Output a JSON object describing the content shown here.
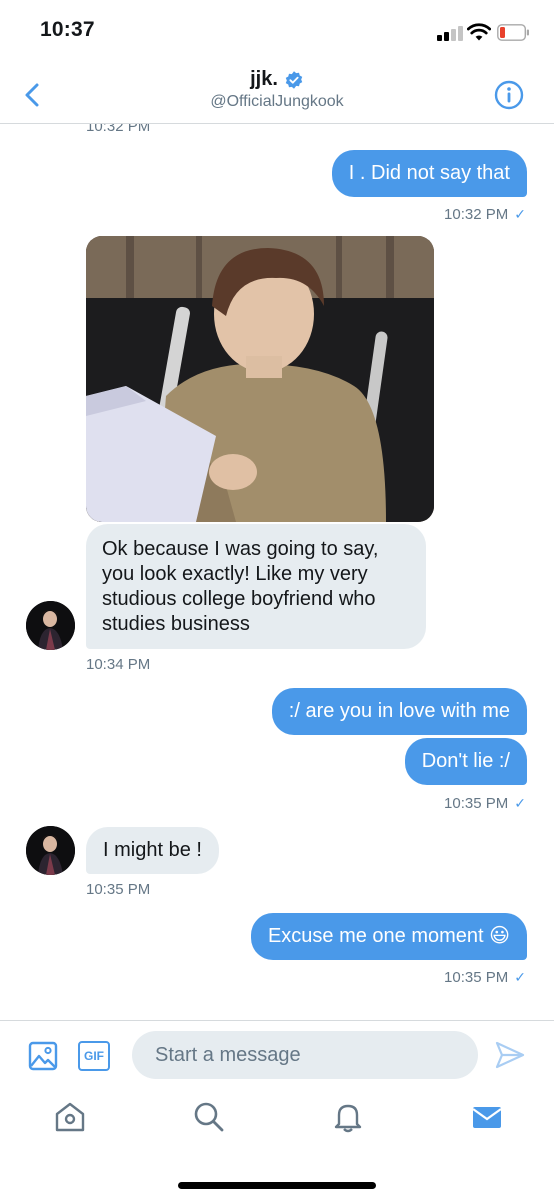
{
  "status_bar": {
    "time": "10:37"
  },
  "header": {
    "name": "jjk.",
    "handle": "@OfficialJungkook"
  },
  "messages": {
    "top_timestamp": "10:32 PM",
    "m1": {
      "text": "I . Did not say that",
      "time": "10:32 PM",
      "check": "✓"
    },
    "m2": {
      "text": "Ok because I was going to say, you look exactly! Like my very studious college boyfriend who studies business",
      "time": "10:34 PM"
    },
    "m3": {
      "text": ":/ are you in love with me"
    },
    "m4": {
      "text": "Don't lie :/",
      "time": "10:35 PM",
      "check": "✓"
    },
    "m5": {
      "text": "I might be !",
      "time": "10:35 PM"
    },
    "m6": {
      "text": "Excuse me one moment 😃",
      "time": "10:35 PM",
      "check": "✓"
    }
  },
  "composer": {
    "placeholder": "Start a message",
    "gif_label": "GIF"
  },
  "colors": {
    "accent": "#4a99e9",
    "incoming_bubble": "#e6ecf0",
    "secondary_text": "#657786"
  },
  "icons": {
    "back": "chevron-left-icon",
    "verified": "verified-badge-icon",
    "info": "info-icon",
    "image": "image-icon",
    "gif": "gif-icon",
    "send": "send-icon",
    "home": "home-icon",
    "search": "search-icon",
    "notifications": "bell-icon",
    "messages": "mail-icon"
  }
}
